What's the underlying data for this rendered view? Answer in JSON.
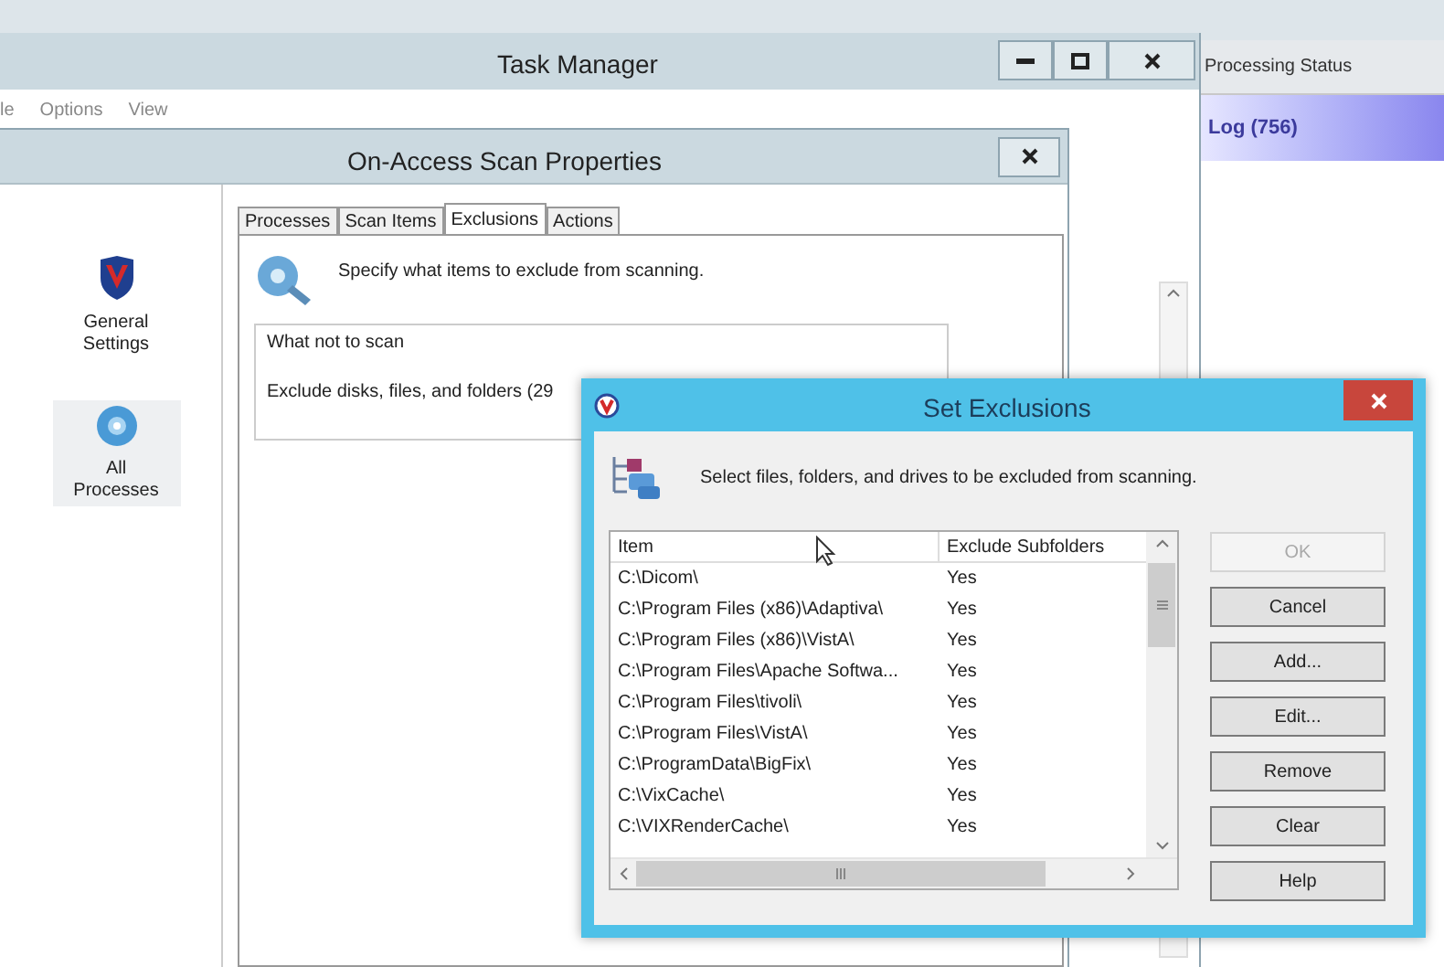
{
  "background_app": {
    "header": "Processing Status",
    "tab": {
      "label": "Log (756)",
      "selected": true
    }
  },
  "task_manager": {
    "title": "Task Manager",
    "menu": [
      "le",
      "Options",
      "View"
    ]
  },
  "scan_properties": {
    "title": "On-Access Scan Properties",
    "sidebar": [
      {
        "label": "General Settings",
        "kind": "shield",
        "selected": false
      },
      {
        "label": "All Processes",
        "kind": "disc",
        "selected": true
      }
    ],
    "tabs": [
      {
        "label": "Processes",
        "selected": false
      },
      {
        "label": "Scan Items",
        "selected": false
      },
      {
        "label": "Exclusions",
        "selected": true
      },
      {
        "label": "Actions",
        "selected": false
      }
    ],
    "description": "Specify what items to exclude from scanning.",
    "group_title": "What not to scan",
    "group_text": "Exclude disks, files, and folders (29"
  },
  "set_exclusions": {
    "title": "Set Exclusions",
    "description": "Select files, folders, and drives to be excluded from scanning.",
    "columns": [
      "Item",
      "Exclude Subfolders"
    ],
    "rows": [
      {
        "item": "C:\\Dicom\\",
        "subfolders": "Yes"
      },
      {
        "item": "C:\\Program Files (x86)\\Adaptiva\\",
        "subfolders": "Yes"
      },
      {
        "item": "C:\\Program Files (x86)\\VistA\\",
        "subfolders": "Yes"
      },
      {
        "item": "C:\\Program Files\\Apache Softwa...",
        "subfolders": "Yes"
      },
      {
        "item": "C:\\Program Files\\tivoli\\",
        "subfolders": "Yes"
      },
      {
        "item": "C:\\Program Files\\VistA\\",
        "subfolders": "Yes"
      },
      {
        "item": "C:\\ProgramData\\BigFix\\",
        "subfolders": "Yes"
      },
      {
        "item": "C:\\VixCache\\",
        "subfolders": "Yes"
      },
      {
        "item": "C:\\VIXRenderCache\\",
        "subfolders": "Yes"
      }
    ],
    "buttons": [
      {
        "label": "OK",
        "disabled": true
      },
      {
        "label": "Cancel",
        "disabled": false
      },
      {
        "label": "Add...",
        "disabled": false
      },
      {
        "label": "Edit...",
        "disabled": false
      },
      {
        "label": "Remove",
        "disabled": false
      },
      {
        "label": "Clear",
        "disabled": false
      },
      {
        "label": "Help",
        "disabled": false
      }
    ]
  }
}
